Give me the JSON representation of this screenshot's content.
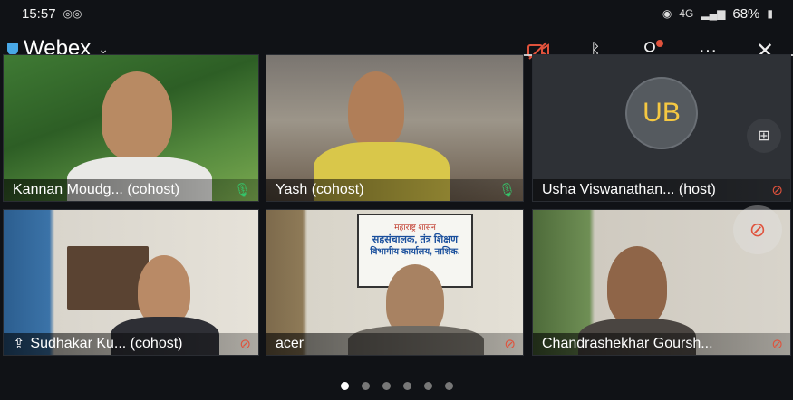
{
  "status": {
    "time": "15:57",
    "battery": "68%",
    "network": "4G"
  },
  "app": {
    "title": "Webex"
  },
  "toolbar": {
    "icons": [
      "camera-off-icon",
      "bluetooth-icon",
      "participants-icon",
      "more-icon",
      "close-icon"
    ]
  },
  "participants": [
    {
      "name": "Kannan Moudg... (cohost)",
      "mic": "on"
    },
    {
      "name": "Yash (cohost)",
      "mic": "on"
    },
    {
      "name": "Usha Viswanathan... (host)",
      "mic": "off",
      "initials": "UB"
    },
    {
      "name": "Sudhakar Ku... (cohost)",
      "mic": "off"
    },
    {
      "name": "acer",
      "mic": "off"
    },
    {
      "name": "Chandrashekhar Goursh...",
      "mic": "off"
    }
  ],
  "sign": {
    "line1": "महाराष्ट्र शासन",
    "line2": "सहसंचालक, तंत्र शिक्षण",
    "line3": "विभागीय कार्यालय, नाशिक."
  },
  "pagination": {
    "pages": 6,
    "current": 1
  },
  "colors": {
    "mic_on": "#35c46a",
    "mic_off": "#e0523c",
    "accent": "#49a8e6"
  }
}
